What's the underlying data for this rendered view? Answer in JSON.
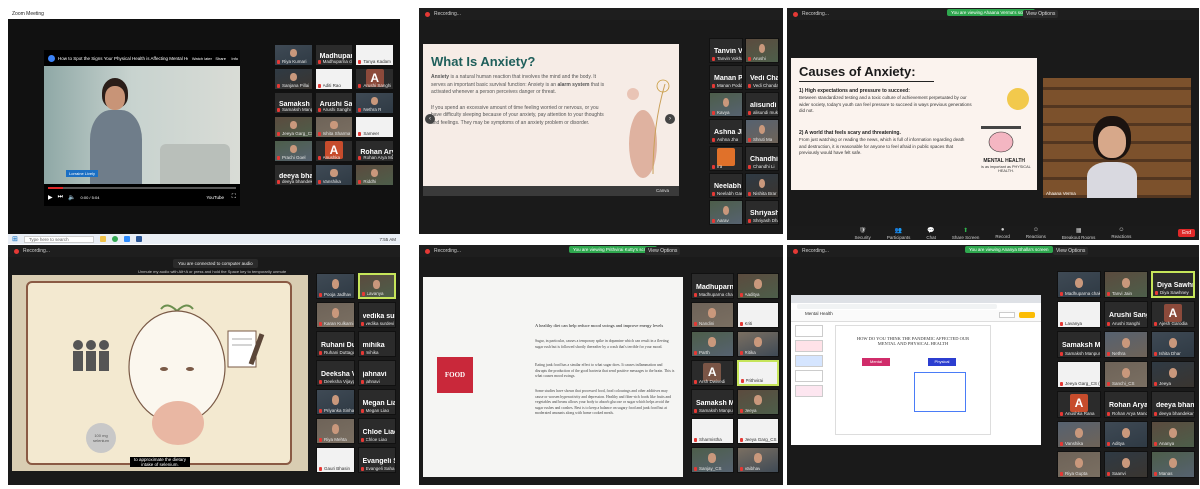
{
  "panel1": {
    "window_title": "Zoom Meeting",
    "video_title": "How to Spot the Signs Your Physical Health is Affecting Mental Health",
    "channel_label": "Watch later",
    "share_label": "Share",
    "more_label": "Info",
    "subtitle_chip": "Lorraine Lively",
    "time_text": "0:00 / 5:04",
    "youtube_label": "YouTube",
    "taskbar_search": "Type here to search",
    "taskbar_time": "7:55 AM",
    "participants": [
      {
        "big": "",
        "name": "Riya Kumari",
        "kind": "video"
      },
      {
        "big": "Madhuparna ch...",
        "name": "Madhuparna chat",
        "kind": "name"
      },
      {
        "big": "",
        "name": "Tanya Kadam",
        "kind": "blank"
      },
      {
        "big": "",
        "name": "Sanjana Pillai",
        "kind": "video"
      },
      {
        "big": "",
        "name": "Aditi Rao",
        "kind": "blank"
      },
      {
        "big": "A",
        "name": "Arushi Sanghi",
        "kind": "avatar",
        "color": "#8c4a3b"
      },
      {
        "big": "Samaksh Manp...",
        "name": "Samaksh Manpuria",
        "kind": "name"
      },
      {
        "big": "Arushi Sanghi",
        "name": "Arushi Sanghi",
        "kind": "name"
      },
      {
        "big": "",
        "name": "Nethra R",
        "kind": "video"
      },
      {
        "big": "",
        "name": "Jeeya Garg_CS",
        "kind": "video"
      },
      {
        "big": "",
        "name": "Ishita Sharma",
        "kind": "video"
      },
      {
        "big": "",
        "name": "Sameer",
        "kind": "blank"
      },
      {
        "big": "",
        "name": "Prachi Goel",
        "kind": "video"
      },
      {
        "big": "A",
        "name": "Anushka",
        "kind": "avatar",
        "color": "#c74c2c"
      },
      {
        "big": "Rohan Arya M...",
        "name": "Rohan Arya Manda",
        "kind": "name"
      },
      {
        "big": "deeya bhandek...",
        "name": "deeya bhandekar",
        "kind": "name"
      },
      {
        "big": "",
        "name": "Vanshika",
        "kind": "video"
      },
      {
        "big": "",
        "name": "Riddhi",
        "kind": "video"
      }
    ]
  },
  "panel2": {
    "recording": "Recording...",
    "slide_title": "What Is Anxiety?",
    "para1_bold1": "Anxiety",
    "para1": "is a natural human reaction that involves the mind and the body. It serves an important basic survival function: Anxiety is an",
    "para1_bold2": "alarm system",
    "para1_end": "that is activated whenever a person perceives danger or threat.",
    "para2": "If you spend an excessive amount of time feeling worried or nervous, or you have difficulty sleeping because of your anxiety, pay attention to your thoughts and feelings. They may be symptoms of an anxiety problem or disorder.",
    "bottom_hint": "Canva",
    "participants": [
      {
        "big": "Tanvin Vokhar",
        "name": "Tanvin Vokhar",
        "kind": "name"
      },
      {
        "big": "",
        "name": "Arushi",
        "kind": "video"
      },
      {
        "big": "Manan Poddar",
        "name": "Manan Poddar",
        "kind": "name"
      },
      {
        "big": "Vedi Chanda I...",
        "name": "Vedi Chanda I",
        "kind": "name"
      },
      {
        "big": "",
        "name": "Kavya",
        "kind": "video"
      },
      {
        "big": "alisundi mukherjee",
        "name": "alisundi mukherjee",
        "kind": "name"
      },
      {
        "big": "Ashna Jha",
        "name": "Ashna Jha",
        "kind": "name"
      },
      {
        "big": "",
        "name": "Shruti Ma",
        "kind": "video"
      },
      {
        "big": "",
        "name": "Ira",
        "kind": "avatar",
        "color": "#e0712a"
      },
      {
        "big": "Chandhi Li...",
        "name": "Chandhi Li",
        "kind": "name"
      },
      {
        "big": "Neelabh Gango...",
        "name": "Neelabh Gangopadhyay",
        "kind": "name"
      },
      {
        "big": "",
        "name": "Nishita Brar",
        "kind": "video"
      },
      {
        "big": "",
        "name": "Aarav",
        "kind": "video"
      },
      {
        "big": "Shriyash Dhanuk",
        "name": "Shriyash Dhanuk",
        "kind": "name"
      }
    ]
  },
  "panel3": {
    "recording": "Recording...",
    "banner": "You are viewing Ahaana Verma's screen",
    "view_options": "View Options",
    "slide_title": "Causes of Anxiety:",
    "h1": "1) High expectations and pressure to succeed:",
    "p1": "Between standardized testing and a toxic culture of achievement perpetuated by our wider society, today's youth can feel pressure to succeed in ways previous generations did not.",
    "h2": "2) A world that feels scary and threatening.",
    "p2": "From just watching or reading the news, which is full of information regarding death and destruction, it is reasonable for anyone to feel afraid in public spaces that previously would have felt safe.",
    "mh_label": "MENTAL HEALTH",
    "mh_sub": "is as important as PHYSICAL HEALTH.",
    "speaker_name": "Ahaana Verma",
    "controls": [
      "Security",
      "Participants",
      "Chat",
      "Share Screen",
      "Record",
      "Reactions",
      "Breakout Rooms",
      "Reactions"
    ],
    "end_label": "End"
  },
  "panel4": {
    "recording": "Recording...",
    "connected_msg": "You are connected to computer audio",
    "tip_msg": "Unmute my audio with Alt+A or press and hold the Space key to temporarily unmute",
    "caption": "to approximate the dietary intake of selenium.",
    "bubble": "100 mg selenium",
    "participants": [
      {
        "big": "",
        "name": "Pooja Jadhav",
        "kind": "video"
      },
      {
        "big": "",
        "name": "Lavanya",
        "kind": "video",
        "active": true
      },
      {
        "big": "",
        "name": "Karan Kulkarni",
        "kind": "video"
      },
      {
        "big": "vedika surdevi",
        "name": "vedika surdevi",
        "kind": "name"
      },
      {
        "big": "Ruhani Duttaga...",
        "name": "Ruhani Duttagupta",
        "kind": "name"
      },
      {
        "big": "mihika",
        "name": "mihika",
        "kind": "name"
      },
      {
        "big": "Deeksha Vijayp...",
        "name": "Deeksha Vijaypal",
        "kind": "name"
      },
      {
        "big": "jahnavi",
        "name": "jahnavi",
        "kind": "name"
      },
      {
        "big": "",
        "name": "Priyanka Sinha",
        "kind": "video"
      },
      {
        "big": "Megan Liao",
        "name": "Megan Liao",
        "kind": "name"
      },
      {
        "big": "",
        "name": "Riya Mehta",
        "kind": "video"
      },
      {
        "big": "Chloe Liao",
        "name": "Chloe Liao",
        "kind": "name"
      },
      {
        "big": "",
        "name": "Gauri Bhasin",
        "kind": "blank"
      },
      {
        "big": "Evangeli Saha",
        "name": "Evangeli Saha",
        "kind": "name"
      }
    ]
  },
  "panel5": {
    "recording": "Recording...",
    "banner": "You are viewing Prithvirai Kutty's screen",
    "view_options": "View Options",
    "food_label": "FOOD",
    "heading": "A healthy diet can help reduce mood swings and improve energy levels",
    "p1": "Sugar, in particular, causes a temporary spike in dopamine which can result in a fleeting sugar rush but is followed shortly thereafter by a crash that's terrible for your mood.",
    "p2": "Eating junk food has a similar effect to what sugar does. It causes inflammation and disrupts the production of the good bacteria that send positive messages to the brain. This is what causes mood swings.",
    "p3": "Some studies have shown that processed food, food colourings and other additives may cause or worsen hyperactivity and depression. Healthy and fiber-rich foods like fruits and vegetables and beans allows your body to absorb glucose or sugar which helps avoid the sugar rushes and crashes. Best is to keep a balance on sugary food and junk food but at moderated amounts along with home cooked meals.",
    "participants": [
      {
        "big": "Madhuparna ch...",
        "name": "Madhuparna chakraborty",
        "kind": "name"
      },
      {
        "big": "",
        "name": "Aaditya",
        "kind": "video"
      },
      {
        "big": "",
        "name": "Nandini",
        "kind": "video"
      },
      {
        "big": "",
        "name": "Kriti",
        "kind": "blank"
      },
      {
        "big": "",
        "name": "Parth",
        "kind": "video"
      },
      {
        "big": "",
        "name": "Ritika",
        "kind": "video"
      },
      {
        "big": "A",
        "name": "Arsh Dwivedi",
        "kind": "avatar",
        "color": "#7a5546"
      },
      {
        "big": "",
        "name": "Prithvirai",
        "kind": "blank",
        "active": true
      },
      {
        "big": "Samaksh Manp...",
        "name": "Samaksh Manpuria",
        "kind": "name"
      },
      {
        "big": "",
        "name": "Jeeya",
        "kind": "video"
      },
      {
        "big": "",
        "name": "Sharmistha",
        "kind": "blank"
      },
      {
        "big": "",
        "name": "Jeeya Garg_CS (Mind...)",
        "kind": "blank"
      },
      {
        "big": "",
        "name": "Sanjay_CS",
        "kind": "video"
      },
      {
        "big": "",
        "name": "Vaibhav",
        "kind": "video"
      }
    ]
  },
  "panel6": {
    "recording": "Recording...",
    "banner": "You are viewing Ananya Bhalla's screen",
    "view_options": "View Options",
    "doc_title": "Mental Health",
    "slide_heading": "HOW DO YOU THINK THE PANDEMIC AFFECTED OUR MENTAL AND PHYSICAL HEALTH",
    "btn_a": "Mental",
    "btn_b": "Physical",
    "participants": [
      {
        "big": "",
        "name": "Madhuparna chakrabo...",
        "kind": "video"
      },
      {
        "big": "",
        "name": "Tanvi Jain",
        "kind": "video"
      },
      {
        "big": "Diya Sawhney",
        "name": "Diya Sawhney",
        "kind": "name",
        "active": true
      },
      {
        "big": "",
        "name": "Lavanya",
        "kind": "blank"
      },
      {
        "big": "Arushi Sanghi",
        "name": "Arushi Sanghi",
        "kind": "name"
      },
      {
        "big": "A",
        "name": "Ajesh Garodia",
        "kind": "avatar",
        "color": "#8c4a3b"
      },
      {
        "big": "Samaksh Manp...",
        "name": "Samaksh Manpuria",
        "kind": "name"
      },
      {
        "big": "",
        "name": "Nethra",
        "kind": "video"
      },
      {
        "big": "",
        "name": "Ishita Dhar",
        "kind": "video"
      },
      {
        "big": "",
        "name": "Jeeya Garg_CS (Mindfu...)",
        "kind": "blank"
      },
      {
        "big": "",
        "name": "Sanchi_CS",
        "kind": "video"
      },
      {
        "big": "",
        "name": "Jeeya",
        "kind": "video"
      },
      {
        "big": "A",
        "name": "Anushka Rana",
        "kind": "avatar",
        "color": "#c74c2c"
      },
      {
        "big": "Rohan Arya M...",
        "name": "Rohan Arya Manda",
        "kind": "name"
      },
      {
        "big": "deeya bhandek...",
        "name": "deeya bhandekar",
        "kind": "name"
      },
      {
        "big": "",
        "name": "Vanshika",
        "kind": "video"
      },
      {
        "big": "",
        "name": "Aditya",
        "kind": "video"
      },
      {
        "big": "",
        "name": "Ananya",
        "kind": "video"
      },
      {
        "big": "",
        "name": "Riya Gupta",
        "kind": "video"
      },
      {
        "big": "",
        "name": "Saanvi",
        "kind": "video"
      },
      {
        "big": "",
        "name": "Manas",
        "kind": "video"
      }
    ]
  },
  "colors": {
    "zoom_dark": "#1a1a1a",
    "active_border": "#c6e55a",
    "banner_green": "#2fa84f",
    "slide_pink": "#f6ece6",
    "food_red": "#c9283a"
  }
}
